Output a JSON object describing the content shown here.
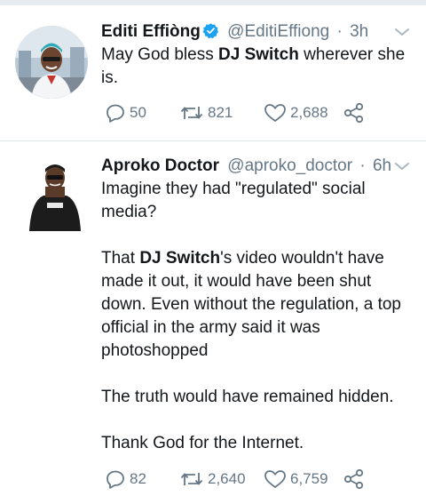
{
  "colors": {
    "text": "#14171a",
    "secondary": "#657786",
    "verified": "#1da1f2",
    "divider": "#e1e8ed"
  },
  "tweets": [
    {
      "name": "Editi Effiòng",
      "verified": true,
      "handle": "@EditiEffiong",
      "separator": "·",
      "time": "3h",
      "text_parts": {
        "a": "May God bless ",
        "b": "DJ Switch",
        "c": " wherever she is."
      },
      "icons": [
        "reply-icon",
        "retweet-icon",
        "like-icon",
        "share-icon"
      ],
      "replies": "50",
      "retweets": "821",
      "likes": "2,688"
    },
    {
      "name": "Aproko Doctor",
      "verified": false,
      "handle": "@aproko_doctor",
      "separator": "·",
      "time": "6h",
      "text_parts": {
        "p1": "Imagine they had \"regulated\" social media?",
        "p2a": "That ",
        "p2b": "DJ Switch",
        "p2c": "'s video wouldn't have made it out, it would have been shut down. Even without the regulation, a top official in the army said it was photoshopped",
        "p3": "The truth would have remained hidden.",
        "p4": "Thank God for the Internet."
      },
      "icons": [
        "reply-icon",
        "retweet-icon",
        "like-icon",
        "share-icon"
      ],
      "replies": "82",
      "retweets": "2,640",
      "likes": "6,759"
    }
  ]
}
